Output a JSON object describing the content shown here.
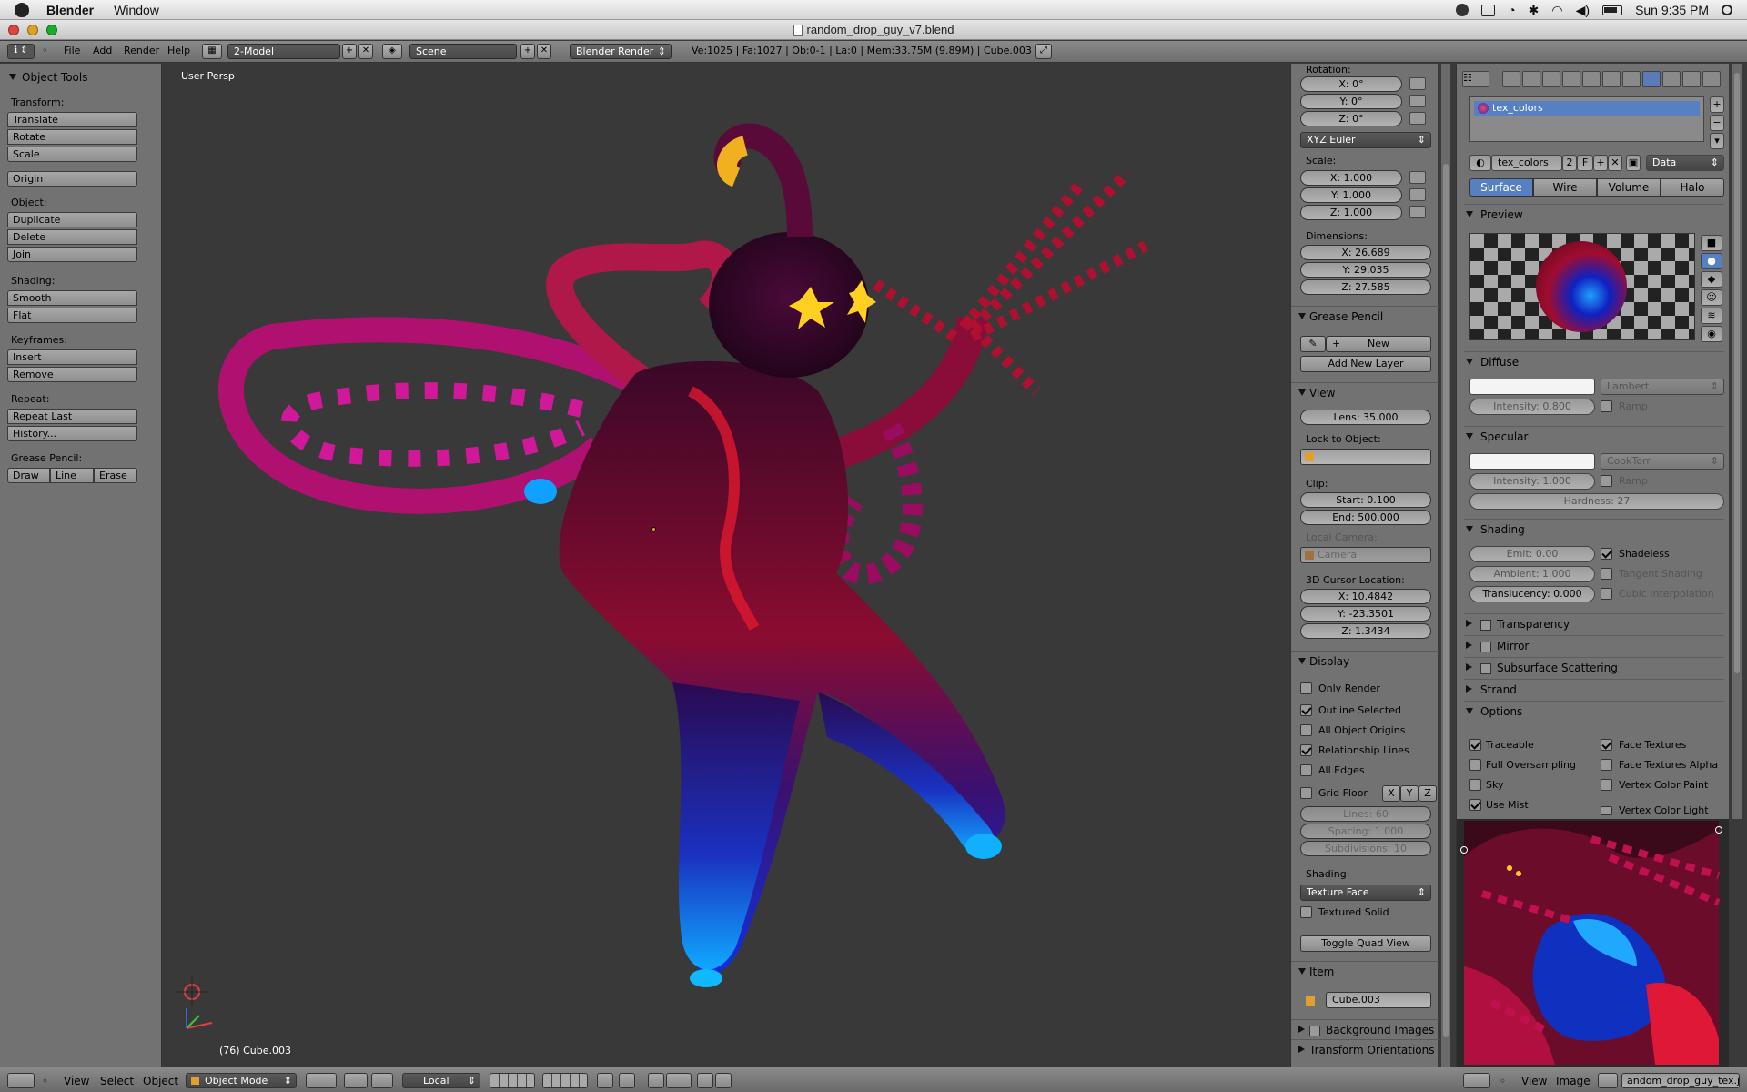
{
  "menubar": {
    "app_name": "Blender",
    "items": [
      "Window"
    ],
    "clock": "Sun 9:35 PM"
  },
  "window": {
    "title": "random_drop_guy_v7.blend"
  },
  "header": {
    "menus": [
      "File",
      "Add",
      "Render",
      "Help"
    ],
    "screen_layout": "2-Model",
    "scene": "Scene",
    "render_engine": "Blender Render",
    "stats": "Ve:1025 | Fa:1027 | Ob:0-1 | La:0 | Mem:33.75M (9.89M) | Cube.003"
  },
  "toolshelf": {
    "title": "Object Tools",
    "transform_label": "Transform:",
    "translate": "Translate",
    "rotate": "Rotate",
    "scale": "Scale",
    "origin": "Origin",
    "object_label": "Object:",
    "duplicate": "Duplicate",
    "delete": "Delete",
    "join": "Join",
    "shading_label": "Shading:",
    "smooth": "Smooth",
    "flat": "Flat",
    "keyframes_label": "Keyframes:",
    "insert": "Insert",
    "remove": "Remove",
    "repeat_label": "Repeat:",
    "repeat_last": "Repeat Last",
    "history": "History...",
    "grease_label": "Grease Pencil:",
    "draw": "Draw",
    "line": "Line",
    "erase": "Erase"
  },
  "viewport": {
    "view_label": "User Persp",
    "object_info": "(76) Cube.003",
    "colors": {
      "body_dark": "#2a0620",
      "body_red": "#c4102a",
      "magenta": "#c01078",
      "blue": "#1030d0",
      "cyan": "#10a0ff",
      "eye": "#ffd020"
    }
  },
  "npanel": {
    "rotation_label": "Rotation:",
    "rot_x": "X: 0°",
    "rot_y": "Y: 0°",
    "rot_z": "Z: 0°",
    "rotation_mode": "XYZ Euler",
    "scale_label": "Scale:",
    "scale_x": "X: 1.000",
    "scale_y": "Y: 1.000",
    "scale_z": "Z: 1.000",
    "dimensions_label": "Dimensions:",
    "dim_x": "X: 26.689",
    "dim_y": "Y: 29.035",
    "dim_z": "Z: 27.585",
    "grease_pencil": "Grease Pencil",
    "new": "New",
    "add_new_layer": "Add New Layer",
    "view": "View",
    "lens": "Lens: 35.000",
    "lock_to_object": "Lock to Object:",
    "clip": "Clip:",
    "clip_start": "Start: 0.100",
    "clip_end": "End: 500.000",
    "local_camera": "Local Camera:",
    "camera": "Camera",
    "cursor_label": "3D Cursor Location:",
    "cur_x": "X: 10.4842",
    "cur_y": "Y: -23.3501",
    "cur_z": "Z: 1.3434",
    "display": "Display",
    "only_render": "Only Render",
    "outline_selected": "Outline Selected",
    "all_object_origins": "All Object Origins",
    "relationship_lines": "Relationship Lines",
    "all_edges": "All Edges",
    "grid_floor": "Grid Floor",
    "axis_x": "X",
    "axis_y": "Y",
    "axis_z": "Z",
    "lines": "Lines: 60",
    "spacing": "Spacing: 1.000",
    "subdivisions": "Subdivisions: 10",
    "shading_label": "Shading:",
    "texture_face": "Texture Face",
    "textured_solid": "Textured Solid",
    "toggle_quad": "Toggle Quad View",
    "item": "Item",
    "item_name": "Cube.003",
    "background_images": "Background Images",
    "transform_orientations": "Transform Orientations"
  },
  "props": {
    "texture_slot": "tex_colors",
    "mat_name": "tex_colors",
    "mat_users": "2",
    "fake": "F",
    "data": "Data",
    "tabs": [
      "Surface",
      "Wire",
      "Volume",
      "Halo"
    ],
    "preview": "Preview",
    "diffuse": "Diffuse",
    "lambert": "Lambert",
    "diffuse_intensity": "Intensity: 0.800",
    "ramp": "Ramp",
    "specular": "Specular",
    "cooktorr": "CookTorr",
    "spec_intensity": "Intensity: 1.000",
    "hardness": "Hardness: 27",
    "shading": "Shading",
    "emit": "Emit: 0.00",
    "shadeless": "Shadeless",
    "ambient": "Ambient: 1.000",
    "tangent_shading": "Tangent Shading",
    "translucency": "Translucency: 0.000",
    "cubic_interpolation": "Cubic Interpolation",
    "transparency": "Transparency",
    "mirror": "Mirror",
    "sss": "Subsurface Scattering",
    "strand": "Strand",
    "options": "Options",
    "traceable": "Traceable",
    "face_textures": "Face Textures",
    "full_oversampling": "Full Oversampling",
    "face_textures_alpha": "Face Textures Alpha",
    "sky": "Sky",
    "vertex_color_paint": "Vertex Color Paint",
    "use_mist": "Use Mist",
    "vertex_color_light": "Vertex Color Light"
  },
  "footer": {
    "view": "View",
    "select": "Select",
    "object": "Object",
    "mode": "Object Mode",
    "orientation": "Local",
    "img_view": "View",
    "img_image": "Image",
    "img_name": "andom_drop_guy_tex.j"
  }
}
